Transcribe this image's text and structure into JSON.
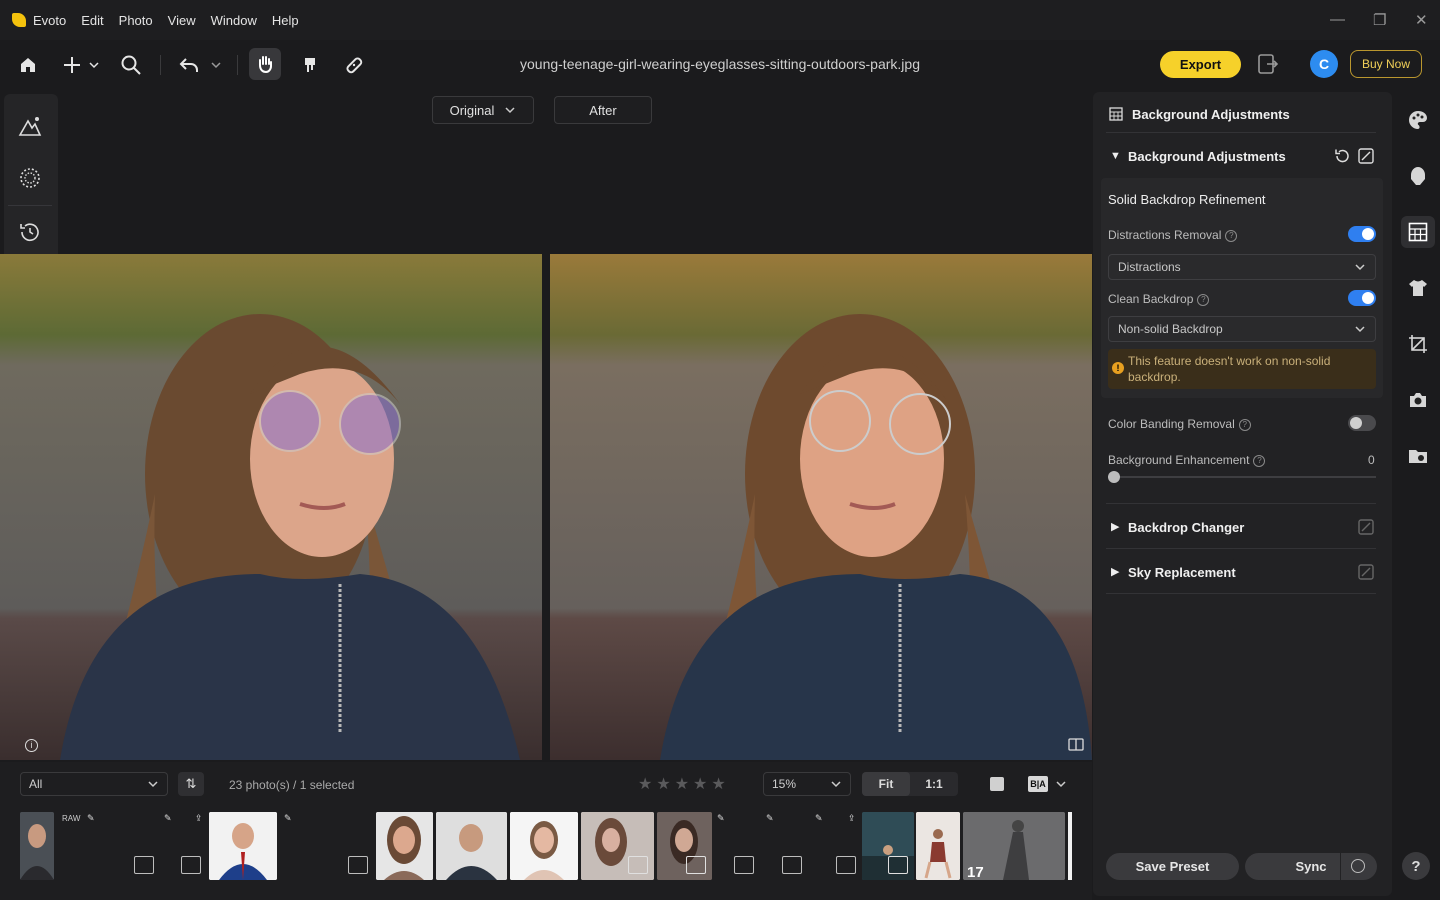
{
  "menubar": {
    "app_name": "Evoto",
    "items": [
      "Edit",
      "Photo",
      "View",
      "Window",
      "Help"
    ]
  },
  "toolbar": {
    "filename": "young-teenage-girl-wearing-eyeglasses-sitting-outdoors-park.jpg",
    "export_label": "Export",
    "avatar_initial": "C",
    "buy_now_label": "Buy Now",
    "icons": [
      "home-icon",
      "add-icon",
      "search-icon",
      "undo-icon",
      "hand-icon",
      "brush-icon",
      "healing-icon"
    ]
  },
  "view_mode": {
    "original_label": "Original",
    "after_label": "After"
  },
  "filmstrip": {
    "filter_value": "All",
    "sort_label": "⇅",
    "photo_count": "23 photo(s) / 1 selected",
    "zoom_value": "15%",
    "zoom_fit_label": "Fit",
    "zoom_1to1_label": "1:1",
    "ba_label": "B|A",
    "raw_label": "RAW",
    "stack_count": "17"
  },
  "panel": {
    "title": "Background Adjustments",
    "section_title": "Background Adjustments",
    "subsection_title": "Solid Backdrop Refinement",
    "distractions_label": "Distractions Removal",
    "distractions_on": true,
    "distractions_select": "Distractions",
    "clean_backdrop_label": "Clean Backdrop",
    "clean_backdrop_on": true,
    "clean_backdrop_select": "Non-solid Backdrop",
    "warning_text": "This feature doesn't work on non-solid backdrop.",
    "color_banding_label": "Color Banding Removal",
    "color_banding_on": false,
    "enhancement_label": "Background Enhancement",
    "enhancement_value": "0",
    "backdrop_changer_label": "Backdrop Changer",
    "sky_replacement_label": "Sky Replacement",
    "save_preset_label": "Save Preset",
    "sync_label": "Sync",
    "help_label": "?"
  },
  "colors": {
    "accent": "#2f7ff0",
    "export": "#f6d12a",
    "buy_now": "#f0cf58"
  }
}
